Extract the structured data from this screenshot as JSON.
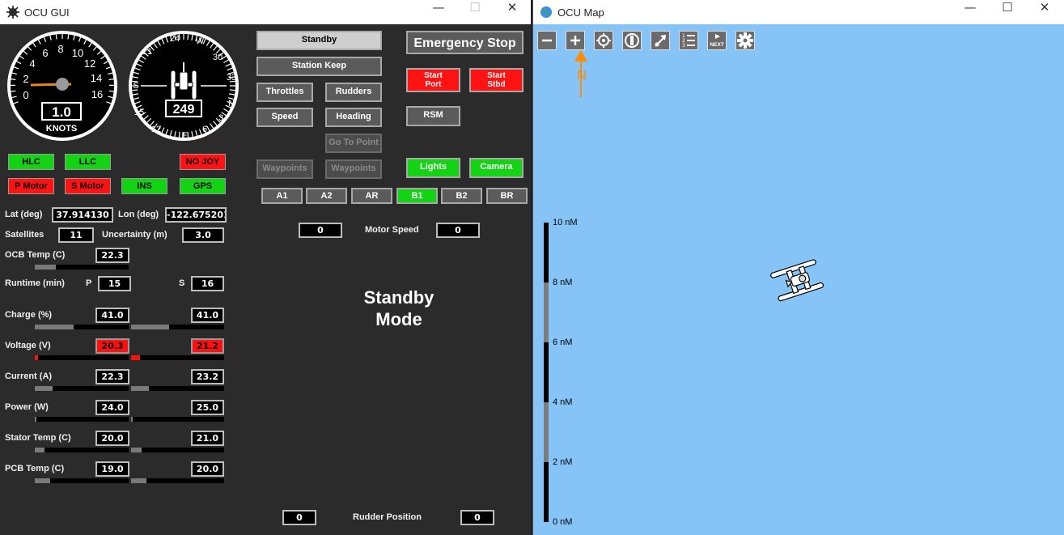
{
  "gui_window": {
    "title": "OCU GUI",
    "minimize": "—",
    "maximize": "☐",
    "close": "✕"
  },
  "speed_gauge": {
    "ticks": [
      "0",
      "2",
      "4",
      "6",
      "8",
      "10",
      "12",
      "14",
      "16"
    ],
    "value": "1.0",
    "unit": "KNOTS",
    "speed_knots": 1.0
  },
  "compass_gauge": {
    "ticks": [
      "24",
      "W",
      "30",
      "33",
      "N",
      "3",
      "6",
      "E",
      "12",
      "15",
      "S",
      "21"
    ],
    "heading": "249"
  },
  "indicators": {
    "hlc": "HLC",
    "llc": "LLC",
    "no_joy": "NO JOY",
    "p_motor": "P Motor",
    "s_motor": "S Motor",
    "ins": "INS",
    "gps": "GPS"
  },
  "telemetry": {
    "lat_label": "Lat (deg)",
    "lat": "37.914130",
    "lon_label": "Lon (deg)",
    "lon": "-122.675201",
    "sat_label": "Satellites",
    "sat": "11",
    "unc_label": "Uncertainty (m)",
    "unc": "3.0",
    "ocb_label": "OCB Temp (C)",
    "ocb": "22.3",
    "runtime_label": "Runtime (min)",
    "p": "P",
    "s": "S",
    "runtime_p": "15",
    "runtime_s": "16",
    "charge_label": "Charge (%)",
    "charge_p": "41.0",
    "charge_s": "41.0",
    "voltage_label": "Voltage (V)",
    "voltage_p": "20.3",
    "voltage_s": "21.2",
    "current_label": "Current (A)",
    "current_p": "22.3",
    "current_s": "23.2",
    "power_label": "Power (W)",
    "power_p": "24.0",
    "power_s": "25.0",
    "stator_label": "Stator Temp (C)",
    "stator_p": "20.0",
    "stator_s": "21.0",
    "pcb_label": "PCB Temp (C)",
    "pcb_p": "19.0",
    "pcb_s": "20.0"
  },
  "controls": {
    "standby": "Standby",
    "station_keep": "Station Keep",
    "throttles": "Throttles",
    "rudders": "Rudders",
    "speed": "Speed",
    "heading": "Heading",
    "go_to_point": "Go To Point",
    "waypoints_1": "Waypoints",
    "waypoints_2": "Waypoints",
    "emergency_stop": "Emergency Stop",
    "start_port_1": "Start",
    "start_port_2": "Port",
    "start_stbd_1": "Start",
    "start_stbd_2": "Stbd",
    "rsm": "RSM",
    "lights": "Lights",
    "camera": "Camera",
    "presets": [
      "A1",
      "A2",
      "AR",
      "B1",
      "B2",
      "BR"
    ],
    "motor_speed_label": "Motor Speed",
    "motor_left": "0",
    "motor_right": "0",
    "mode_line1": "Standby",
    "mode_line2": "Mode",
    "rudder_label": "Rudder Position",
    "rudder_left": "0",
    "rudder_right": "0"
  },
  "map_window": {
    "title": "OCU Map",
    "minimize": "—",
    "maximize": "☐",
    "close": "✕"
  },
  "map": {
    "scale_labels": [
      "10 nM",
      "8 nM",
      "6 nM",
      "4 nM",
      "2 nM",
      "0 nM"
    ],
    "next_label": "NEXT",
    "north_label": "N",
    "colors": {
      "water": "#86c4f8",
      "north_arrow": "#ff8c00"
    }
  }
}
